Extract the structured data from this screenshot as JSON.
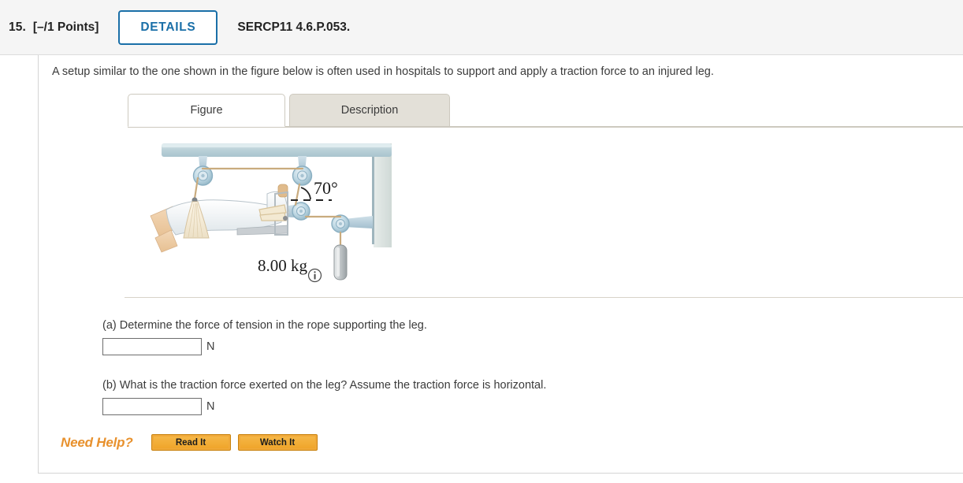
{
  "header": {
    "question_number": "15.",
    "points": "[–/1 Points]",
    "details_label": "DETAILS",
    "question_code": "SERCP11 4.6.P.053."
  },
  "question": {
    "intro": "A setup similar to the one shown in the figure below is often used in hospitals to support and apply a traction force to an injured leg.",
    "parts": [
      {
        "prompt": "(a) Determine the force of tension in the rope supporting the leg.",
        "value": "",
        "placeholder": "",
        "unit": "N"
      },
      {
        "prompt": "(b) What is the traction force exerted on the leg? Assume the traction force is horizontal.",
        "value": "",
        "placeholder": "",
        "unit": "N"
      }
    ]
  },
  "tabs": [
    {
      "label": "Figure",
      "selected": true
    },
    {
      "label": "Description",
      "selected": false
    }
  ],
  "figure": {
    "angle_label": "70°",
    "mass_label": "8.00 kg",
    "info_icon": "info-icon",
    "colors": {
      "rail": "#c3d4da",
      "pulley": "#b7d0dd",
      "rope": "#d7c09c",
      "wall": "#dfe5e2"
    }
  },
  "help": {
    "label": "Need Help?",
    "read_it": "Read It",
    "watch_it": "Watch It"
  },
  "colors": {
    "accent_blue": "#1a6fa8",
    "header_bg": "#f5f5f5",
    "text": "#3b3b3b",
    "help_orange": "#e8912d",
    "tab_border": "#cdc9bf",
    "tab_inactive_bg": "#e3e0d8"
  }
}
